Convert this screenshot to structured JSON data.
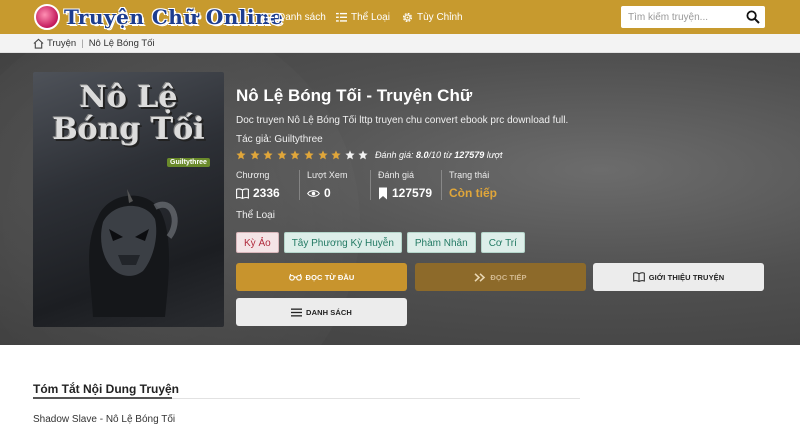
{
  "site": {
    "logo_text": "Truyện Chữ Online"
  },
  "nav": [
    {
      "label": "Danh sách",
      "icon": "list-icon"
    },
    {
      "label": "Thể Loại",
      "icon": "category-list-icon"
    },
    {
      "label": "Tùy Chỉnh",
      "icon": "gear-icon"
    }
  ],
  "search": {
    "placeholder": "Tìm kiếm truyện...",
    "icon": "search-icon"
  },
  "breadcrumb": {
    "home": "Truyện",
    "current": "Nô Lệ Bóng Tối"
  },
  "cover": {
    "title_line1": "Nô Lệ",
    "title_line2": "Bóng Tối",
    "badge": "Guiltythree"
  },
  "novel": {
    "title": "Nô Lệ Bóng Tối - Truyện Chữ",
    "description": "Doc truyen Nô Lệ Bóng Tối lttp truyen chu convert ebook prc download full.",
    "author_label": "Tác giả:",
    "author": "Guiltythree",
    "stars_filled": 8,
    "stars_total": 10,
    "rating_label": "Đánh giá:",
    "rating_value": "8.0",
    "rating_scale": "/10 từ",
    "rating_count": "127579",
    "rating_unit": "lượt"
  },
  "stats": {
    "chapters_label": "Chương",
    "chapters_value": "2336",
    "views_label": "Lượt Xem",
    "views_value": "0",
    "reviews_label": "Đánh giá",
    "reviews_value": "127579",
    "status_label": "Trạng thái",
    "status_value": "Còn tiếp"
  },
  "genres": {
    "label": "Thể Loại",
    "items": [
      "Kỳ Ảo",
      "Tây Phương Kỳ Huyễn",
      "Phàm Nhân",
      "Cơ Trí"
    ]
  },
  "buttons": {
    "read_first": "ĐỌC TỪ ĐẦU",
    "read_next": "ĐỌC TIẾP",
    "intro": "GIỚI THIỆU TRUYỆN",
    "list": "DANH SÁCH"
  },
  "summary": {
    "heading": "Tóm Tắt Nội Dung Truyện",
    "first_line": "Shadow Slave - Nô Lệ Bóng Tối"
  },
  "colors": {
    "header": "#c79a2e",
    "accent": "#c8942d",
    "status": "#e0a63a"
  }
}
